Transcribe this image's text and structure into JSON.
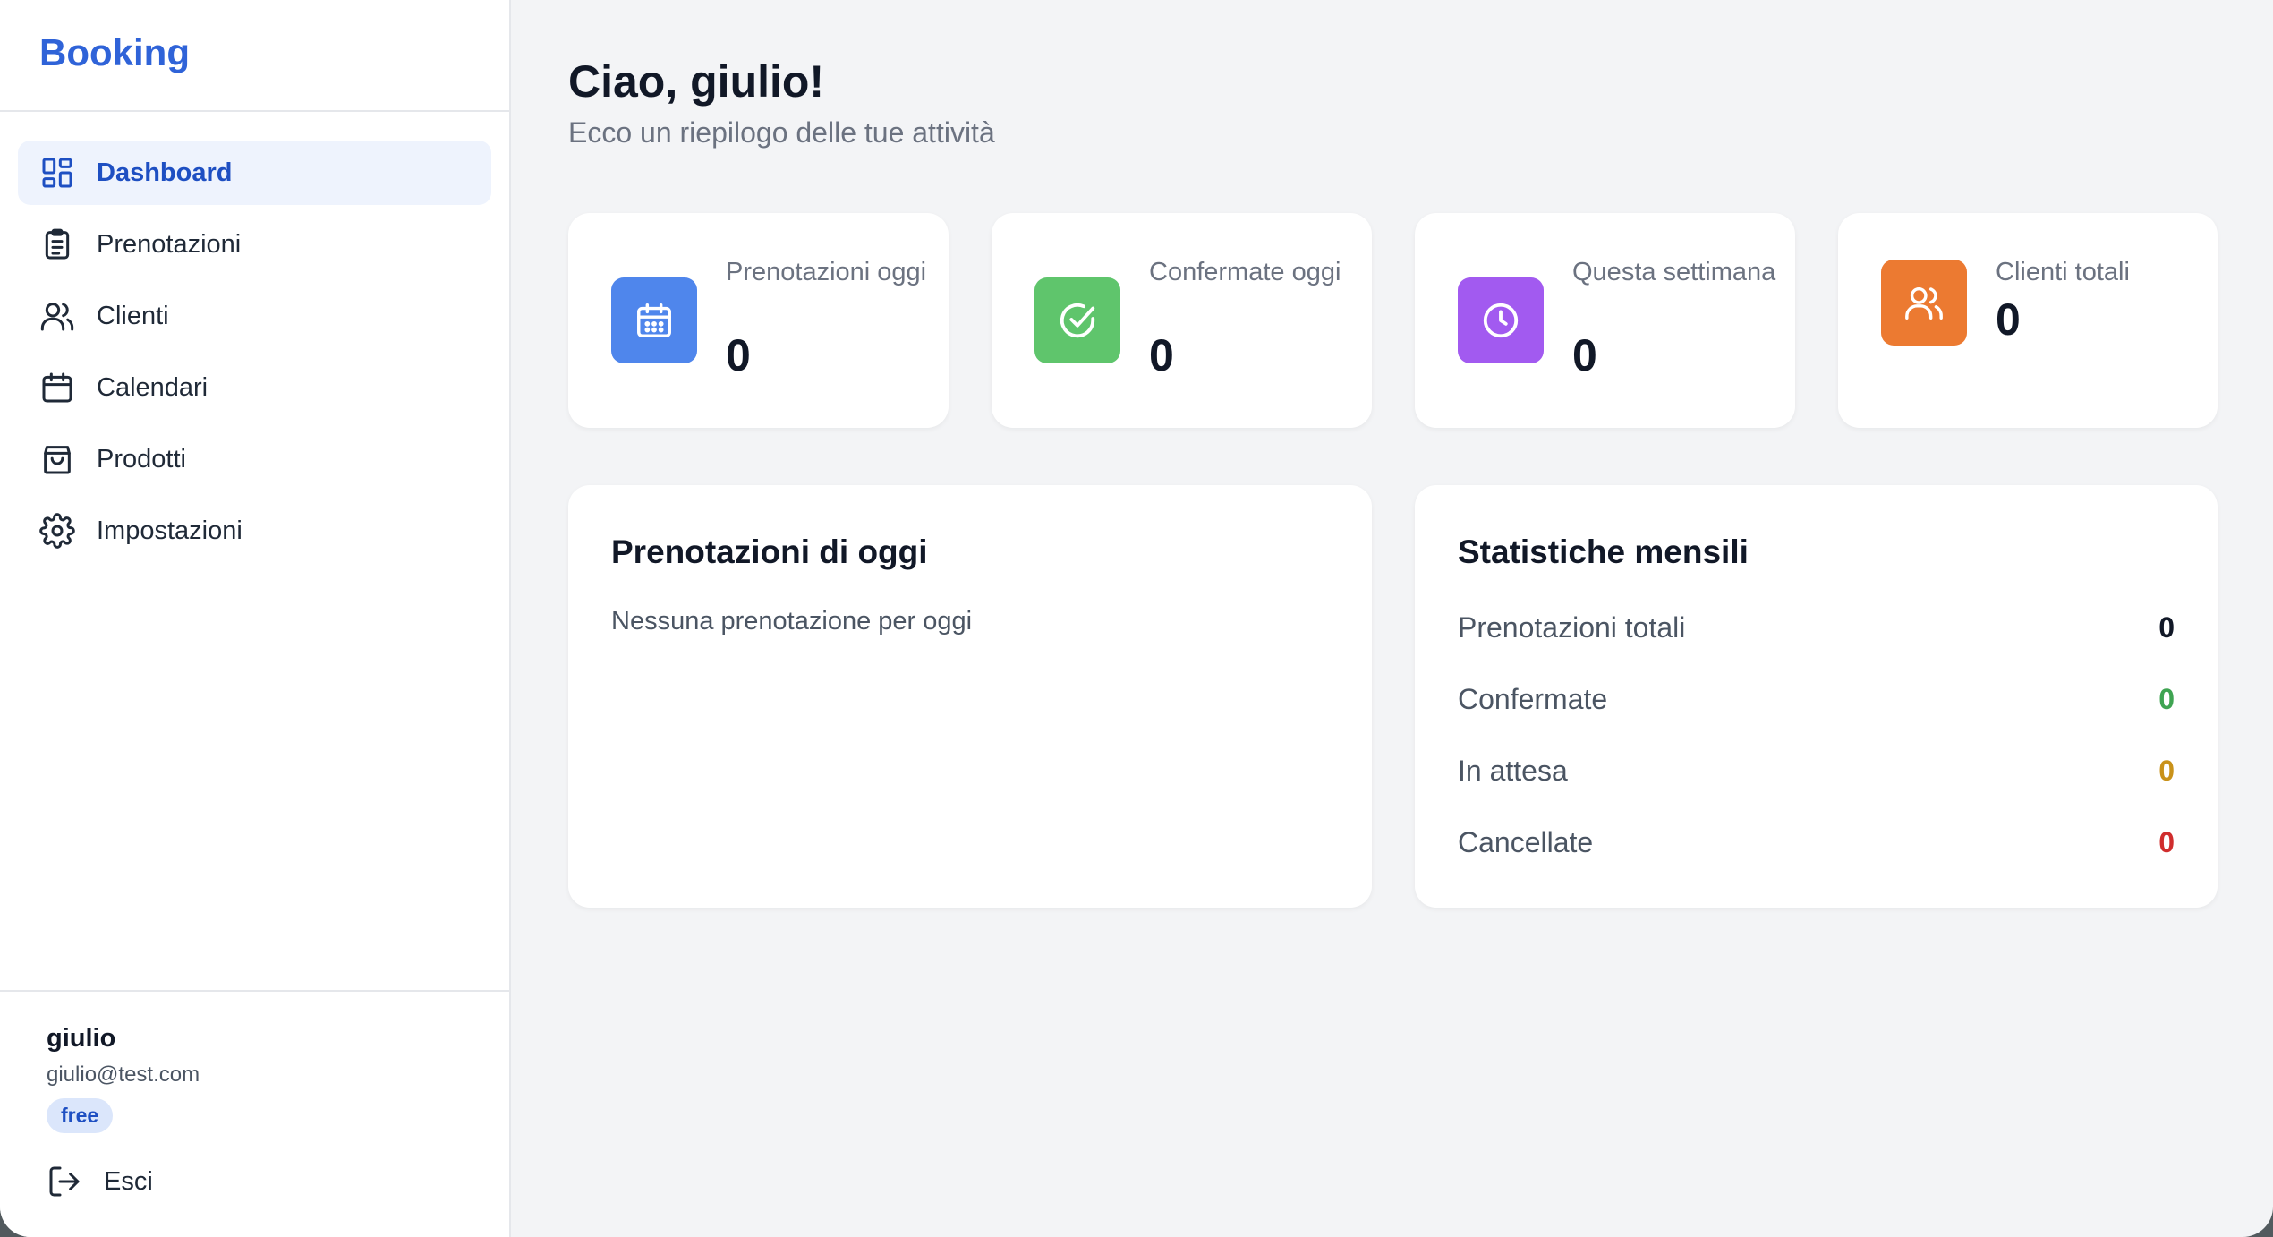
{
  "brand": "Booking",
  "nav": [
    {
      "label": "Dashboard",
      "icon": "dashboard-icon",
      "active": true
    },
    {
      "label": "Prenotazioni",
      "icon": "clipboard-icon"
    },
    {
      "label": "Clienti",
      "icon": "users-icon"
    },
    {
      "label": "Calendari",
      "icon": "calendar-icon"
    },
    {
      "label": "Prodotti",
      "icon": "shopping-bag-icon"
    },
    {
      "label": "Impostazioni",
      "icon": "gear-icon"
    }
  ],
  "user": {
    "name": "giulio",
    "email": "giulio@test.com",
    "plan": "free"
  },
  "logout_label": "Esci",
  "header": {
    "greeting": "Ciao, giulio!",
    "subtitle": "Ecco un riepilogo delle tue attività"
  },
  "stats": [
    {
      "label": "Prenotazioni oggi",
      "value": "0",
      "icon": "calendar-icon",
      "color": "#4f86ec"
    },
    {
      "label": "Confermate oggi",
      "value": "0",
      "icon": "check-circle-icon",
      "color": "#5fc56c"
    },
    {
      "label": "Questa settimana",
      "value": "0",
      "icon": "clock-icon",
      "color": "#a25af0"
    },
    {
      "label": "Clienti totali",
      "value": "0",
      "icon": "users-icon",
      "color": "#ec7a31"
    }
  ],
  "today_panel": {
    "title": "Prenotazioni di oggi",
    "empty": "Nessuna prenotazione per oggi"
  },
  "monthly_panel": {
    "title": "Statistiche mensili",
    "rows": [
      {
        "label": "Prenotazioni totali",
        "value": "0",
        "color": "#111827"
      },
      {
        "label": "Confermate",
        "value": "0",
        "color": "#3fa452"
      },
      {
        "label": "In attesa",
        "value": "0",
        "color": "#c9921a"
      },
      {
        "label": "Cancellate",
        "value": "0",
        "color": "#d02d2d"
      }
    ]
  }
}
